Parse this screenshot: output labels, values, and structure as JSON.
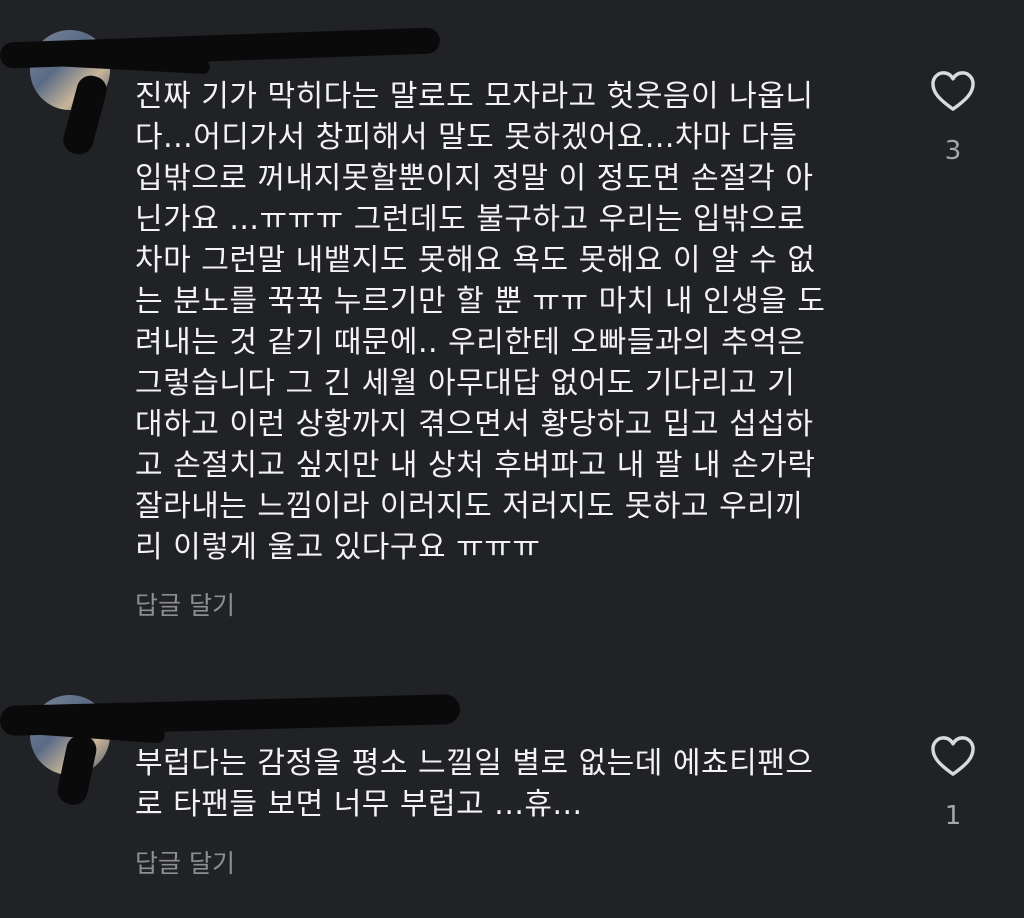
{
  "comments": [
    {
      "username": "",
      "time": "",
      "text": "진짜 기가 막히다는 말로도 모자라고 헛웃음이 나옵니\n다...어디가서 창피해서 말도 못하겠어요...차마 다들\n입밖으로 꺼내지못할뿐이지 정말 이 정도면 손절각 아\n닌가요 ...ㅠㅠㅠ 그런데도 불구하고 우리는 입밖으로\n차마 그런말 내뱉지도 못해요 욕도 못해요 이 알 수 없\n는 분노를 꾹꾹 누르기만 할 뿐 ㅠㅠ 마치 내 인생을 도\n려내는 것 같기 때문에.. 우리한테 오빠들과의 추억은\n그렇습니다  그 긴 세월 아무대답 없어도 기다리고 기\n대하고 이런 상황까지 겪으면서 황당하고 밉고 섭섭하\n고 손절치고 싶지만 내 상처 후벼파고 내 팔 내 손가락\n잘라내는 느낌이라 이러지도 저러지도 못하고 우리끼\n리 이렇게 울고 있다구요 ㅠㅠㅠ",
      "reply_label": "답글 달기",
      "like_count": "3",
      "like_icon": "heart-outline-icon"
    },
    {
      "username": "",
      "time": "",
      "text": "부럽다는 감정을 평소 느낄일 별로 없는데 에쵸티팬으\n로 타팬들 보면 너무 부럽고 ...휴...",
      "reply_label": "답글 달기",
      "like_count": "1",
      "like_icon": "heart-outline-icon"
    }
  ],
  "colors": {
    "background": "#212226",
    "text": "#f3f3f3",
    "muted": "#8c8e94"
  }
}
